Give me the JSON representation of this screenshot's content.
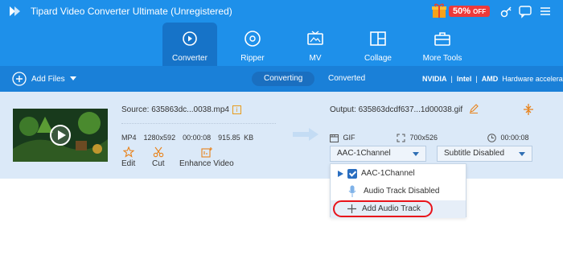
{
  "app": {
    "title": "Tipard Video Converter Ultimate (Unregistered)"
  },
  "promo": {
    "percent": "50%",
    "suffix": "OFF"
  },
  "nav": {
    "items": [
      {
        "label": "Converter"
      },
      {
        "label": "Ripper"
      },
      {
        "label": "MV"
      },
      {
        "label": "Collage"
      },
      {
        "label": "More Tools"
      }
    ]
  },
  "toolbar": {
    "add_files": "Add Files",
    "tabs": [
      {
        "label": "Converting"
      },
      {
        "label": "Converted"
      }
    ],
    "hw_nvidia": "NVIDIA",
    "hw_intel": "Intel",
    "hw_amd": "AMD",
    "hw_label": "Hardware accelerat"
  },
  "file": {
    "source": "Source: 635863dc...0038.mp4",
    "format": "MP4",
    "resolution": "1280x592",
    "duration": "00:00:08",
    "size": "915.85 KB",
    "actions": [
      {
        "label": "Edit"
      },
      {
        "label": "Cut"
      },
      {
        "label": "Enhance Video"
      }
    ]
  },
  "output": {
    "name": "Output: 635863dcdf637...1d00038.gif",
    "format": "GIF",
    "resolution": "700x526",
    "duration": "00:00:08",
    "audio_select": "AAC-1Channel",
    "subtitle_select": "Subtitle Disabled"
  },
  "audio_menu": {
    "items": [
      {
        "label": "AAC-1Channel"
      },
      {
        "label": "Audio Track Disabled"
      },
      {
        "label": "Add Audio Track"
      }
    ]
  },
  "colors": {
    "brand": "#1e90ea",
    "accent": "#ee3a3a",
    "highlight_ring": "#e8121a"
  }
}
